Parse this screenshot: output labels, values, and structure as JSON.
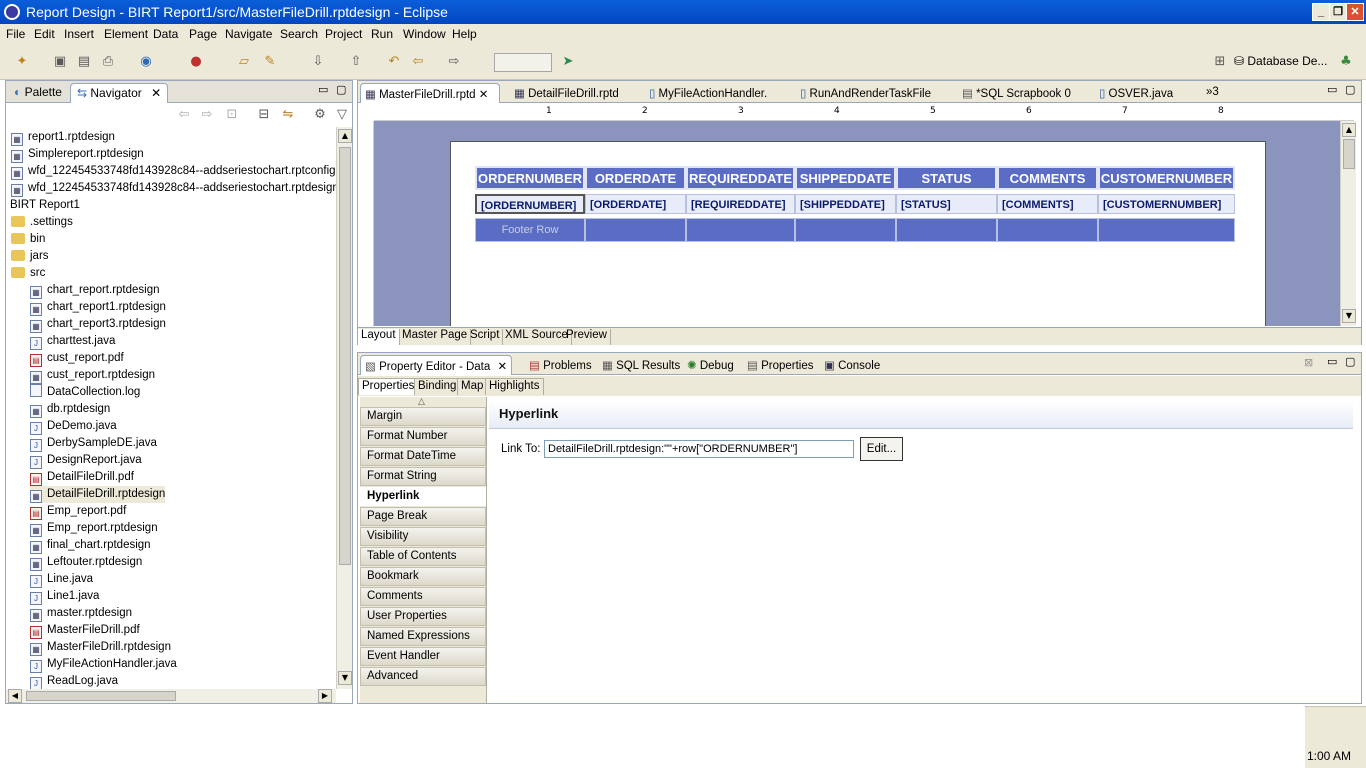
{
  "window": {
    "title": "Report Design - BIRT Report1/src/MasterFileDrill.rptdesign - Eclipse"
  },
  "menu": [
    "File",
    "Edit",
    "Insert",
    "Element",
    "Data",
    "Page",
    "Navigate",
    "Search",
    "Project",
    "Run",
    "Window",
    "Help"
  ],
  "toolbar": {
    "perspective_label": "Database De..."
  },
  "navigator": {
    "tabs": [
      "Palette",
      "Navigator"
    ],
    "items": [
      {
        "label": "report1.rptdesign",
        "icon": "rptdesign-icon",
        "indent": 0
      },
      {
        "label": "Simplereport.rptdesign",
        "icon": "rptdesign-icon",
        "indent": 0
      },
      {
        "label": "wfd_122454533748fd143928c84--addseriestochart.rptconfig",
        "icon": "rptconfig-icon",
        "indent": 0
      },
      {
        "label": "wfd_122454533748fd143928c84--addseriestochart.rptdesign",
        "icon": "rptdesign-icon",
        "indent": 0
      },
      {
        "label": "BIRT Report1",
        "icon": "",
        "indent": -1
      },
      {
        "label": ".settings",
        "icon": "folder-icon",
        "indent": 0
      },
      {
        "label": "bin",
        "icon": "folder-icon",
        "indent": 0
      },
      {
        "label": "jars",
        "icon": "folder-icon",
        "indent": 0
      },
      {
        "label": "src",
        "icon": "folder-icon",
        "indent": 0
      },
      {
        "label": "chart_report.rptdesign",
        "icon": "rptdesign-icon",
        "indent": 1
      },
      {
        "label": "chart_report1.rptdesign",
        "icon": "rptdesign-icon",
        "indent": 1
      },
      {
        "label": "chart_report3.rptdesign",
        "icon": "rptdesign-icon",
        "indent": 1
      },
      {
        "label": "charttest.java",
        "icon": "java-icon",
        "indent": 1
      },
      {
        "label": "cust_report.pdf",
        "icon": "pdf-icon",
        "indent": 1
      },
      {
        "label": "cust_report.rptdesign",
        "icon": "rptdesign-icon",
        "indent": 1
      },
      {
        "label": "DataCollection.log",
        "icon": "file-icon",
        "indent": 1
      },
      {
        "label": "db.rptdesign",
        "icon": "rptdesign-icon",
        "indent": 1
      },
      {
        "label": "DeDemo.java",
        "icon": "java-icon",
        "indent": 1
      },
      {
        "label": "DerbySampleDE.java",
        "icon": "java-icon",
        "indent": 1
      },
      {
        "label": "DesignReport.java",
        "icon": "java-icon",
        "indent": 1
      },
      {
        "label": "DetailFileDrill.pdf",
        "icon": "pdf-icon",
        "indent": 1
      },
      {
        "label": "DetailFileDrill.rptdesign",
        "icon": "rptdesign-icon",
        "indent": 1,
        "selected": true
      },
      {
        "label": "Emp_report.pdf",
        "icon": "pdf-icon",
        "indent": 1
      },
      {
        "label": "Emp_report.rptdesign",
        "icon": "rptdesign-icon",
        "indent": 1
      },
      {
        "label": "final_chart.rptdesign",
        "icon": "rptdesign-icon",
        "indent": 1
      },
      {
        "label": "Leftouter.rptdesign",
        "icon": "rptdesign-icon",
        "indent": 1
      },
      {
        "label": "Line.java",
        "icon": "java-icon",
        "indent": 1
      },
      {
        "label": "Line1.java",
        "icon": "java-icon",
        "indent": 1
      },
      {
        "label": "master.rptdesign",
        "icon": "rptdesign-icon",
        "indent": 1
      },
      {
        "label": "MasterFileDrill.pdf",
        "icon": "pdf-icon",
        "indent": 1
      },
      {
        "label": "MasterFileDrill.rptdesign",
        "icon": "rptdesign-icon",
        "indent": 1
      },
      {
        "label": "MyFileActionHandler.java",
        "icon": "java-icon",
        "indent": 1
      },
      {
        "label": "ReadLog.java",
        "icon": "java-icon",
        "indent": 1
      }
    ]
  },
  "editor": {
    "tabs": [
      "MasterFileDrill.rptd",
      "DetailFileDrill.rptd",
      "MyFileActionHandler.",
      "RunAndRenderTaskFile",
      "*SQL Scrapbook 0",
      "OSVER.java"
    ],
    "overflow": "»3",
    "ruler_marks": [
      "1",
      "2",
      "3",
      "4",
      "5",
      "6",
      "7",
      "8"
    ],
    "columns": [
      "ORDERNUMBER",
      "ORDERDATE",
      "REQUIREDDATE",
      "SHIPPEDDATE",
      "STATUS",
      "COMMENTS",
      "CUSTOMERNUMBER"
    ],
    "data_row": [
      "[ORDERNUMBER]",
      "[ORDERDATE]",
      "[REQUIREDDATE]",
      "[SHIPPEDDATE]",
      "[STATUS]",
      "[COMMENTS]",
      "[CUSTOMERNUMBER]"
    ],
    "footer_label": "Footer Row",
    "bottom_tabs": [
      "Layout",
      "Master Page",
      "Script",
      "XML Source",
      "Preview"
    ]
  },
  "properties": {
    "tabs": [
      "Property Editor - Data",
      "Problems",
      "SQL Results",
      "Debug",
      "Properties",
      "Console"
    ],
    "subtabs": [
      "Properties",
      "Binding",
      "Map",
      "Highlights"
    ],
    "categories": [
      "Margin",
      "Format Number",
      "Format DateTime",
      "Format String",
      "Hyperlink",
      "Page Break",
      "Visibility",
      "Table of Contents",
      "Bookmark",
      "Comments",
      "User Properties",
      "Named Expressions",
      "Event Handler",
      "Advanced"
    ],
    "selected_category": "Hyperlink",
    "section_title": "Hyperlink",
    "link_label": "Link To:",
    "link_value": "DetailFileDrill.rptdesign:\"\"+row[\"ORDERNUMBER\"]",
    "edit_button": "Edit..."
  },
  "taskbar": {
    "clock": "1:00 AM"
  }
}
